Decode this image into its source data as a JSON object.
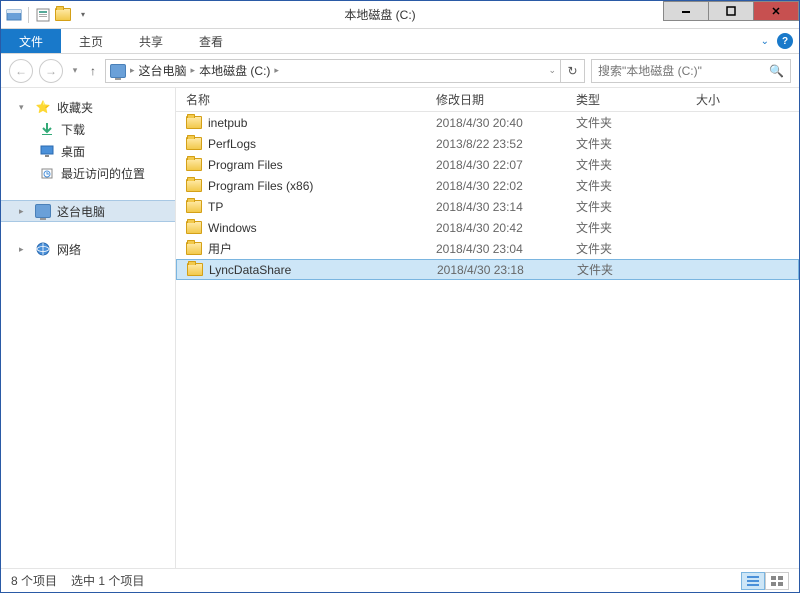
{
  "title": "本地磁盘 (C:)",
  "ribbon": {
    "file": "文件",
    "home": "主页",
    "share": "共享",
    "view": "查看"
  },
  "breadcrumb": {
    "pc": "这台电脑",
    "drive": "本地磁盘 (C:)"
  },
  "search_placeholder": "搜索\"本地磁盘 (C:)\"",
  "nav": {
    "favorites": "收藏夹",
    "downloads": "下载",
    "desktop": "桌面",
    "recent": "最近访问的位置",
    "this_pc": "这台电脑",
    "network": "网络"
  },
  "columns": {
    "name": "名称",
    "date": "修改日期",
    "type": "类型",
    "size": "大小"
  },
  "type_folder": "文件夹",
  "items": [
    {
      "name": "inetpub",
      "date": "2018/4/30 20:40",
      "selected": false
    },
    {
      "name": "PerfLogs",
      "date": "2013/8/22 23:52",
      "selected": false
    },
    {
      "name": "Program Files",
      "date": "2018/4/30 22:07",
      "selected": false
    },
    {
      "name": "Program Files (x86)",
      "date": "2018/4/30 22:02",
      "selected": false
    },
    {
      "name": "TP",
      "date": "2018/4/30 23:14",
      "selected": false
    },
    {
      "name": "Windows",
      "date": "2018/4/30 20:42",
      "selected": false
    },
    {
      "name": "用户",
      "date": "2018/4/30 23:04",
      "selected": false
    },
    {
      "name": "LyncDataShare",
      "date": "2018/4/30 23:18",
      "selected": true
    }
  ],
  "status": {
    "count": "8 个项目",
    "selected": "选中 1 个项目"
  }
}
